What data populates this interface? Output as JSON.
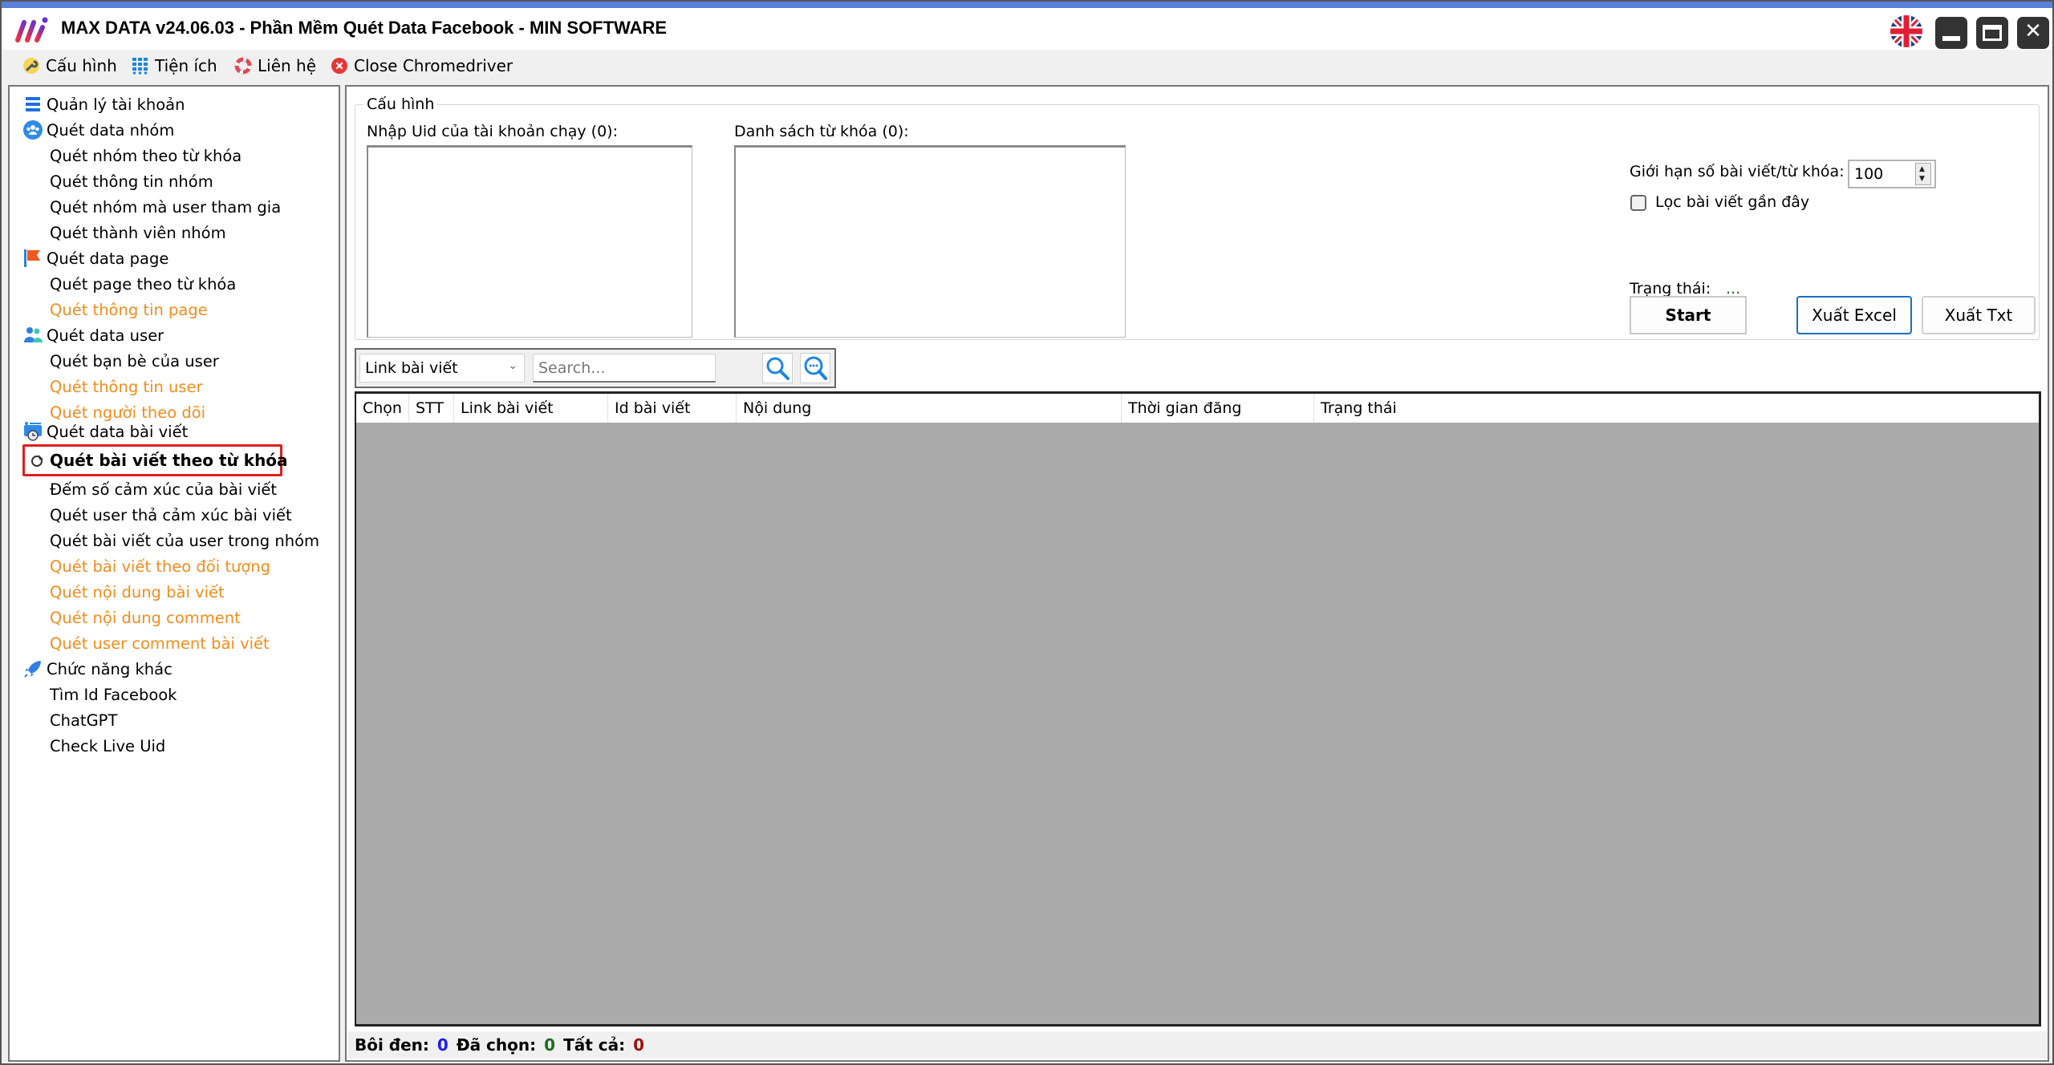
{
  "window": {
    "title": "MAX DATA v24.06.03 - Phần Mềm Quét Data Facebook - MIN SOFTWARE",
    "logo_icon": "max-data-logo",
    "language_icon": "uk-flag-icon",
    "controls": {
      "minimize": "minimize",
      "maximize": "maximize",
      "close": "✕"
    }
  },
  "menubar": {
    "items": [
      {
        "label": "Cấu hình",
        "icon": "wrench-icon"
      },
      {
        "label": "Tiện ích",
        "icon": "grid-dots-icon"
      },
      {
        "label": "Liên hệ",
        "icon": "lifebuoy-icon"
      },
      {
        "label": "Close Chromedriver",
        "icon": "close-circle-icon"
      }
    ]
  },
  "sidebar": {
    "items": [
      {
        "label": "Quản lý tài khoản",
        "type": "group",
        "icon": "list-icon"
      },
      {
        "label": "Quét data nhóm",
        "type": "group",
        "icon": "group-icon"
      },
      {
        "label": "Quét nhóm theo từ khóa",
        "type": "child"
      },
      {
        "label": "Quét thông tin nhóm",
        "type": "child"
      },
      {
        "label": "Quét nhóm mà user tham gia",
        "type": "child"
      },
      {
        "label": "Quét thành viên nhóm",
        "type": "child"
      },
      {
        "label": "Quét data page",
        "type": "group",
        "icon": "flag-icon"
      },
      {
        "label": "Quét page theo từ khóa",
        "type": "child"
      },
      {
        "label": "Quét thông tin page",
        "type": "child",
        "disabled": true
      },
      {
        "label": "Quét data user",
        "type": "group",
        "icon": "users-icon"
      },
      {
        "label": "Quét bạn bè của user",
        "type": "child"
      },
      {
        "label": "Quét thông tin user",
        "type": "child",
        "disabled": true
      },
      {
        "label": "Quét người theo dõi",
        "type": "child",
        "disabled": true
      },
      {
        "label": "Quét data bài viết",
        "type": "group",
        "icon": "post-clock-icon"
      },
      {
        "label": "Quét bài viết theo từ khóa",
        "type": "child",
        "selected": true,
        "icon": "pointer-icon"
      },
      {
        "label": "Đếm số cảm xúc của bài viết",
        "type": "child"
      },
      {
        "label": "Quét user thả cảm xúc bài viết",
        "type": "child"
      },
      {
        "label": "Quét bài viết của user trong nhóm",
        "type": "child"
      },
      {
        "label": "Quét bài viết theo đối tượng",
        "type": "child",
        "disabled": true
      },
      {
        "label": "Quét nội dung bài viết",
        "type": "child",
        "disabled": true
      },
      {
        "label": "Quét nội dung comment",
        "type": "child",
        "disabled": true
      },
      {
        "label": "Quét user comment bài viết",
        "type": "child",
        "disabled": true
      },
      {
        "label": "Chức năng khác",
        "type": "group",
        "icon": "rocket-icon"
      },
      {
        "label": "Tìm Id Facebook",
        "type": "child"
      },
      {
        "label": "ChatGPT",
        "type": "child"
      },
      {
        "label": "Check Live Uid",
        "type": "child"
      }
    ]
  },
  "config": {
    "legend": "Cấu hình",
    "uid_label": "Nhập Uid của tài khoản chạy (0):",
    "uid_value": "",
    "keywords_label": "Danh sách từ khóa (0):",
    "keywords_value": "",
    "limit_label": "Giới hạn số bài viết/từ khóa:",
    "limit_value": "100",
    "recent_filter_label": "Lọc bài viết gần đây",
    "recent_filter_checked": false,
    "status_label": "Trạng thái:",
    "status_value": "...",
    "start_label": "Start",
    "export_excel_label": "Xuất Excel",
    "export_txt_label": "Xuất Txt"
  },
  "search": {
    "field_selected": "Link bài viết",
    "placeholder": "Search...",
    "value": "",
    "search_icon": "search-icon",
    "advanced_search_icon": "search-more-icon"
  },
  "table": {
    "columns": [
      "Chọn",
      "STT",
      "Link bài viết",
      "Id bài viết",
      "Nội dung",
      "Thời gian đăng",
      "Trạng thái"
    ],
    "rows": []
  },
  "footer": {
    "highlighted_label": "Bôi đen:",
    "highlighted_value": "0",
    "selected_label": "Đã chọn:",
    "selected_value": "0",
    "total_label": "Tất cả:",
    "total_value": "0"
  },
  "colors": {
    "accent_blue": "#1a6fc2",
    "disabled_orange": "#f28c1c",
    "selection_red": "#e01e1e",
    "grid_background": "#ababab",
    "status_green": "#1f6b1f"
  }
}
